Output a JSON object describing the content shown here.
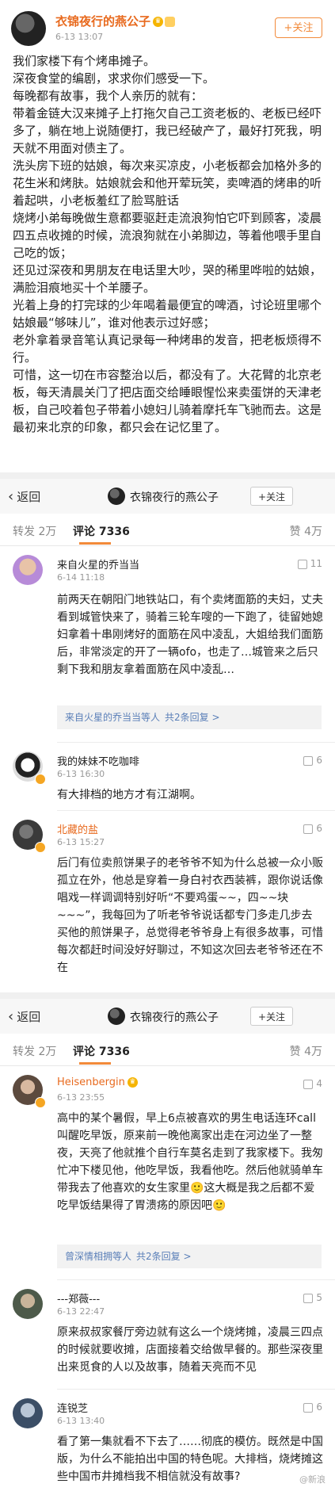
{
  "post": {
    "author": "衣锦夜行的燕公子",
    "time": "6-13 13:07",
    "follow": "+关注",
    "paragraphs": [
      "我们家楼下有个烤串摊子。",
      "深夜食堂的编剧，求求你们感受一下。",
      "每晚都有故事，我个人亲历的就有：",
      "带着金链大汉来摊子上打拖欠自己工资老板的、老板已经吓多了，躺在地上说随便打，我已经破产了，最好打死我，明天就不用面对债主了。",
      "洗头房下班的姑娘，每次来买凉皮，小老板都会加格外多的花生米和烤肤。姑娘就会和他开荤玩笑，卖啤酒的烤串的听着起哄，小老板羞红了脸骂脏话",
      "烧烤小弟每晚做生意都要驱赶走流浪狗怕它吓到顾客，凌晨四五点收摊的时候，流浪狗就在小弟脚边，等着他喂手里自己吃的饭；",
      "还见过深夜和男朋友在电话里大吵，哭的稀里哗啦的姑娘，满脸泪痕地买十个羊腰子。",
      "光着上身的打完球的少年喝着最便宜的啤酒，讨论班里哪个姑娘最“够味儿”，谁对他表示过好感；",
      "老外拿着录音笔认真记录每一种烤串的发音，把老板烦得不行。",
      "可惜，这一切在市容整治以后，都没有了。大花臂的北京老板，每天清晨关门了把店面交给睡眼惺忪来卖蛋饼的天津老板，自己咬着包子带着小媳妇儿骑着摩托车飞驰而去。这是最初来北京的印象，都只会在记忆里了。"
    ]
  },
  "nav": {
    "back": "返回",
    "title": "衣锦夜行的燕公子",
    "follow": "+关注"
  },
  "tabs": {
    "repost": "转发 2万",
    "comments": "评论 7336",
    "likes": "赞 4万"
  },
  "comments_a": [
    {
      "name": "来自火星的乔当当",
      "time": "6-14 11:18",
      "likes": "11",
      "text": "前两天在朝阳门地铁站口，有个卖烤面筋的夫妇，丈夫看到城管快来了，骑着三轮车嗖的一下跑了，徒留她媳妇拿着十串刚烤好的面筋在风中凌乱，大姐给我们面筋后，非常淡定的开了一辆ofo，也走了…城管来之后只剩下我和朋友拿着面筋在风中凌乱…",
      "reply_names": "来自火星的乔当当等人",
      "reply_count": "共2条回复 >"
    },
    {
      "name": "我的妹妹不吃咖啡",
      "time": "6-13 16:30",
      "likes": "6",
      "text": "有大排档的地方才有江湖啊。"
    },
    {
      "name": "北藏的盐",
      "time": "6-13 15:27",
      "likes": "6",
      "text": "后门有位卖煎饼果子的老爷爷不知为什么总被一众小贩孤立在外，他总是穿着一身白衬衣西装裤，跟你说话像唱戏一样调调特别好听“不要鸡蛋~~，四~~块~~~”，我每回为了听老爷爷说话都专门多走几步去买他的煎饼果子，总觉得老爷爷身上有很多故事，可惜每次都赶时间没好好聊过，不知这次回去老爷爷还在不在"
    }
  ],
  "comments_b": [
    {
      "name": "Heisenbergin",
      "time": "6-13 23:55",
      "likes": "4",
      "text": "高中的某个暑假，早上6点被喜欢的男生电话连环call叫醒吃早饭，原来前一晚他离家出走在河边坐了一整夜，天亮了他就推个自行车莫名走到了我家楼下。我匆忙冲下楼见他，他吃早饭，我看他吃。然后他就骑单车带我去了他喜欢的女生家里🙂这大概是我之后都不爱吃早饭结果得了胃溃疡的原因吧🙂",
      "reply_names": "曾深情相拥等人",
      "reply_count": "共2条回复 >"
    },
    {
      "name": "---郑薇---",
      "time": "6-13 22:47",
      "likes": "5",
      "text": "原来叔叔家餐厅旁边就有这么一个烧烤摊，凌晨三四点的时候就要收摊，店面接着交给做早餐的。那些深夜里出来觅食的人以及故事，随着天亮而不见"
    },
    {
      "name": "连锐芝",
      "time": "6-13 13:40",
      "likes": "6",
      "text": "看了第一集就看不下去了……彻底的模仿。既然是中国版，为什么不能拍出中国的特色呢。大排档，烧烤摊这些中国市井摊档我不相信就没有故事?"
    }
  ],
  "watermark": "@新浪"
}
